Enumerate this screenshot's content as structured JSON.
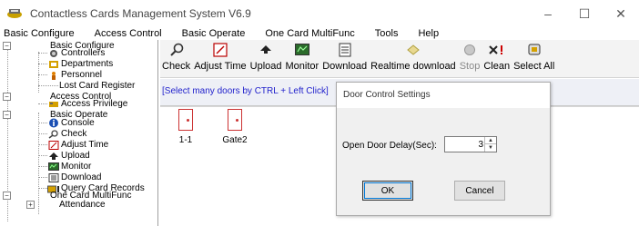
{
  "window": {
    "title": "Contactless Cards Management System  V6.9",
    "controls": {
      "minimize": "–",
      "maximize": "☐",
      "close": "✕"
    }
  },
  "menu": [
    {
      "label": "Basic Configure"
    },
    {
      "label": "Access Control"
    },
    {
      "label": "Basic Operate"
    },
    {
      "label": "One Card MultiFunc"
    },
    {
      "label": "Tools"
    },
    {
      "label": "Help"
    }
  ],
  "tree": {
    "basic_configure": "Basic Configure",
    "controllers": "Controllers",
    "departments": "Departments",
    "personnel": "Personnel",
    "lost_card_register": "Lost Card Register",
    "access_control": "Access Control",
    "access_privilege": "Access Privilege",
    "basic_operate": "Basic Operate",
    "console": "Console",
    "check": "Check",
    "adjust_time": "Adjust Time",
    "upload": "Upload",
    "monitor": "Monitor",
    "download": "Download",
    "query_card_records": "Query Card Records",
    "one_card_multifunc": "One Card MultiFunc",
    "attendance": "Attendance"
  },
  "toolbar": {
    "check": "Check",
    "adjust_time": "Adjust Time",
    "upload": "Upload",
    "monitor": "Monitor",
    "download": "Download",
    "realtime_download": "Realtime download",
    "stop": "Stop",
    "clean": "Clean",
    "select_all": "Select All"
  },
  "main": {
    "hint": "[Select many doors by CTRL + Left Click]",
    "doors": [
      {
        "label": "1-1"
      },
      {
        "label": "Gate2"
      }
    ]
  },
  "dialog": {
    "title": "Door Control Settings",
    "open_delay_label": "Open Door Delay(Sec):",
    "open_delay_value": "3",
    "ok": "OK",
    "cancel": "Cancel"
  },
  "colors": {
    "hint_text": "#2222cc",
    "door_icon": "#cc3333",
    "dialog_bg": "#f0f0f0"
  }
}
